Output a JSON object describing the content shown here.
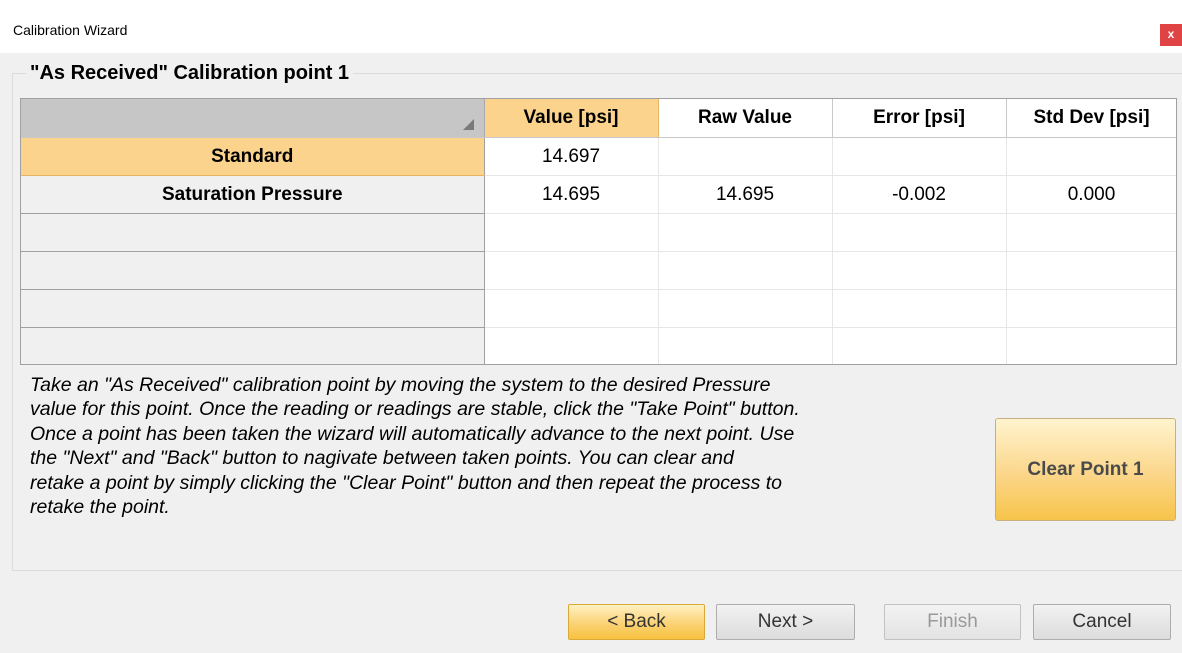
{
  "window": {
    "title": "Calibration Wizard",
    "close_label": "x"
  },
  "group": {
    "title": "\"As Received\" Calibration point 1"
  },
  "grid": {
    "columns": [
      "Value [psi]",
      "Raw Value",
      "Error [psi]",
      "Std Dev [psi]"
    ],
    "rows": [
      {
        "label": "Standard",
        "cells": [
          "14.697",
          "",
          "",
          ""
        ]
      },
      {
        "label": "Saturation Pressure",
        "cells": [
          "14.695",
          "14.695",
          "-0.002",
          "0.000"
        ]
      },
      {
        "label": "",
        "cells": [
          "",
          "",
          "",
          ""
        ]
      },
      {
        "label": "",
        "cells": [
          "",
          "",
          "",
          ""
        ]
      },
      {
        "label": "",
        "cells": [
          "",
          "",
          "",
          ""
        ]
      },
      {
        "label": "",
        "cells": [
          "",
          "",
          "",
          ""
        ]
      }
    ]
  },
  "instructions": "Take an \"As Received\" calibration point by moving the system to the desired Pressure\nvalue for this point.  Once the reading or readings are stable, click the \"Take Point\" button.\n Once a point has been taken the wizard will automatically advance to the next point.  Use\nthe \"Next\" and \"Back\" button to nagivate between taken points.  You can clear and\nretake a point by simply clicking the \"Clear Point\" button and then repeat the process to\nretake the point.",
  "buttons": {
    "clear_point": "Clear Point 1",
    "back": "< Back",
    "next": "Next >",
    "finish": "Finish",
    "cancel": "Cancel"
  },
  "colors": {
    "accent": "#fbd38c",
    "close": "#e04343",
    "header_corner": "#c6c6c6"
  },
  "icons": {
    "close": "close-icon",
    "sort": "sort-indicator-icon"
  }
}
